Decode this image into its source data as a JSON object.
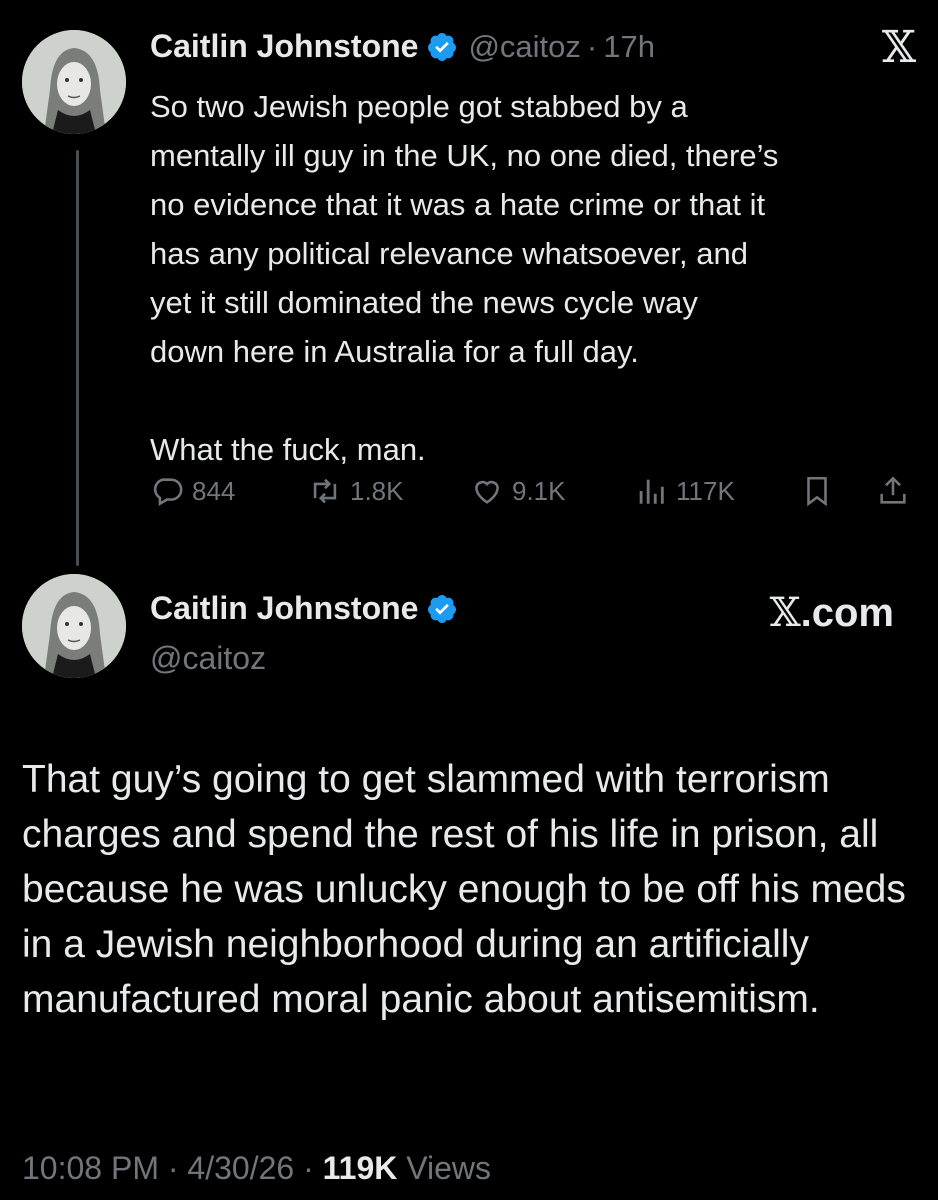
{
  "tweet": {
    "author_name": "Caitlin Johnstone",
    "handle": "@caitoz",
    "separator": "·",
    "time_ago": "17h",
    "text": "So two Jewish people got stabbed by a\nmentally ill guy in the UK, no one died, there’s\nno evidence that it was a hate crime or that it\nhas any political relevance whatsoever, and\nyet it still dominated the news cycle way\ndown here in Australia for a full day.\n\nWhat the fuck, man.",
    "stats": {
      "replies": "844",
      "reposts": "1.8K",
      "likes": "9.1K",
      "views": "117K"
    }
  },
  "quoted": {
    "author_name": "Caitlin Johnstone",
    "handle": "@caitoz",
    "site_label": ".com",
    "text": "That guy’s going to get slammed with terrorism charges and spend the rest of his life in prison, all because he was unlucky enough to be off his meds in a Jewish neighborhood during an artificially manufactured moral panic about antisemitism.",
    "timestamp": "10:08 PM · 4/30/26 · ",
    "views_count": "119K",
    "views_label": " Views"
  },
  "icons": {
    "x_logo": "x-logo-icon",
    "badge": "verified-badge-icon",
    "reply": "reply-icon",
    "repost": "repost-icon",
    "like": "heart-icon",
    "views": "views-bar-chart-icon",
    "bookmark": "bookmark-icon",
    "share": "share-icon"
  },
  "colors": {
    "background": "#000000",
    "text": "#e7e9ea",
    "muted": "#71767b",
    "verified": "#1d9bf0"
  }
}
